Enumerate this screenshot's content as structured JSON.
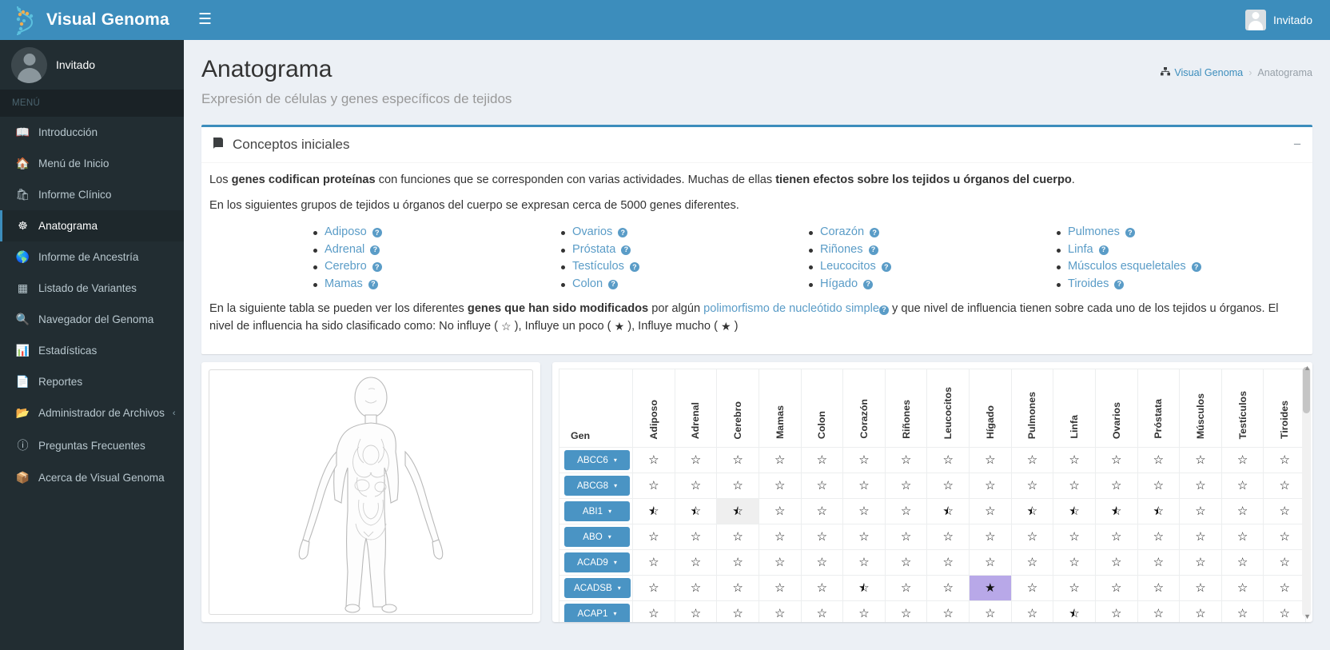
{
  "brand": {
    "name": "Visual Genoma",
    "logo_icon": "dna-icon"
  },
  "navbar": {
    "menu_toggle_icon": "hamburger-icon",
    "user_label": "Invitado",
    "user_icon": "user-avatar-icon"
  },
  "sidebar": {
    "user": {
      "name": "Invitado"
    },
    "menu_header": "MENÚ",
    "items": [
      {
        "label": "Introducción",
        "icon": "book-icon",
        "active": false
      },
      {
        "label": "Menú de Inicio",
        "icon": "home-icon",
        "active": false
      },
      {
        "label": "Informe Clínico",
        "icon": "medkit-icon",
        "active": false
      },
      {
        "label": "Anatograma",
        "icon": "anatogram-icon",
        "active": true
      },
      {
        "label": "Informe de Ancestría",
        "icon": "globe-icon",
        "active": false
      },
      {
        "label": "Listado de Variantes",
        "icon": "grid-icon",
        "active": false
      },
      {
        "label": "Navegador del Genoma",
        "icon": "search-icon",
        "active": false
      },
      {
        "label": "Estadísticas",
        "icon": "bar-chart-icon",
        "active": false
      },
      {
        "label": "Reportes",
        "icon": "file-icon",
        "active": false
      },
      {
        "label": "Administrador de Archivos",
        "icon": "folder-open-icon",
        "active": false,
        "caret": "‹"
      },
      {
        "label": "Preguntas Frecuentes",
        "icon": "question-circle-icon",
        "active": false
      },
      {
        "label": "Acerca de Visual Genoma",
        "icon": "cube-icon",
        "active": false
      }
    ]
  },
  "page": {
    "title": "Anatograma",
    "subtitle": "Expresión de células y genes específicos de tejidos",
    "breadcrumb": {
      "home_icon": "sitemap-icon",
      "home": "Visual Genoma",
      "separator": "›",
      "current": "Anatograma"
    }
  },
  "concepts_box": {
    "icon": "book-icon",
    "title": "Conceptos iniciales",
    "collapse_icon": "−",
    "p1_a": "Los ",
    "p1_b": "genes codifican proteínas",
    "p1_c": " con funciones que se corresponden con varias actividades. Muchas de ellas ",
    "p1_d": "tienen efectos sobre los tejidos u órganos del cuerpo",
    "p1_e": ".",
    "p2": "En los siguientes grupos de tejidos u órganos del cuerpo se expresan cerca de 5000 genes diferentes.",
    "tissues": [
      [
        "Adiposo",
        "Adrenal",
        "Cerebro",
        "Mamas"
      ],
      [
        "Ovarios",
        "Próstata",
        "Testículos",
        "Colon"
      ],
      [
        "Corazón",
        "Riñones",
        "Leucocitos",
        "Hígado"
      ],
      [
        "Pulmones",
        "Linfa",
        "Músculos esqueletales",
        "Tiroides"
      ]
    ],
    "p3_a": "En la siguiente tabla se pueden ver los diferentes ",
    "p3_b": "genes que han sido modificados",
    "p3_c": " por algún ",
    "p3_link": "polimorfismo de nucleótido simple",
    "p3_d": " y que nivel de influencia tienen sobre cada uno de los tejidos u órganos. El nivel de influencia ha sido clasificado como: No influye ( ",
    "star_empty": "☆",
    "p3_e": " ), Influye un poco ( ",
    "star_half": "★",
    "p3_f": " ), Influye mucho ( ",
    "star_full": "★",
    "p3_g": " )"
  },
  "anatogram": {
    "alt": "human-body-diagram"
  },
  "gene_table": {
    "gen_header": "Gen",
    "columns": [
      "Adiposo",
      "Adrenal",
      "Cerebro",
      "Mamas",
      "Colon",
      "Corazón",
      "Riñones",
      "Leucocitos",
      "Hígado",
      "Pulmones",
      "Linfa",
      "Ovarios",
      "Próstata",
      "Músculos",
      "Testículos",
      "Tiroides"
    ],
    "caret": "▾",
    "rows": [
      {
        "gene": "ABCC6",
        "values": [
          0,
          0,
          0,
          0,
          0,
          0,
          0,
          0,
          0,
          0,
          0,
          0,
          0,
          0,
          0,
          0
        ]
      },
      {
        "gene": "ABCG8",
        "values": [
          0,
          0,
          0,
          0,
          0,
          0,
          0,
          0,
          0,
          0,
          0,
          0,
          0,
          0,
          0,
          0
        ]
      },
      {
        "gene": "ABI1",
        "values": [
          1,
          1,
          1,
          0,
          0,
          0,
          0,
          1,
          0,
          1,
          1,
          1,
          1,
          0,
          0,
          0
        ]
      },
      {
        "gene": "ABO",
        "values": [
          0,
          0,
          0,
          0,
          0,
          0,
          0,
          0,
          0,
          0,
          0,
          0,
          0,
          0,
          0,
          0
        ]
      },
      {
        "gene": "ACAD9",
        "values": [
          0,
          0,
          0,
          0,
          0,
          0,
          0,
          0,
          0,
          0,
          0,
          0,
          0,
          0,
          0,
          0
        ]
      },
      {
        "gene": "ACADSB",
        "values": [
          0,
          0,
          0,
          0,
          0,
          1,
          0,
          0,
          2,
          0,
          0,
          0,
          0,
          0,
          0,
          0
        ]
      },
      {
        "gene": "ACAP1",
        "values": [
          0,
          0,
          0,
          0,
          0,
          0,
          0,
          0,
          0,
          0,
          1,
          0,
          0,
          0,
          0,
          0
        ]
      }
    ],
    "highlight_col": 2,
    "highlight_purple": {
      "row": 5,
      "col": 8
    }
  }
}
